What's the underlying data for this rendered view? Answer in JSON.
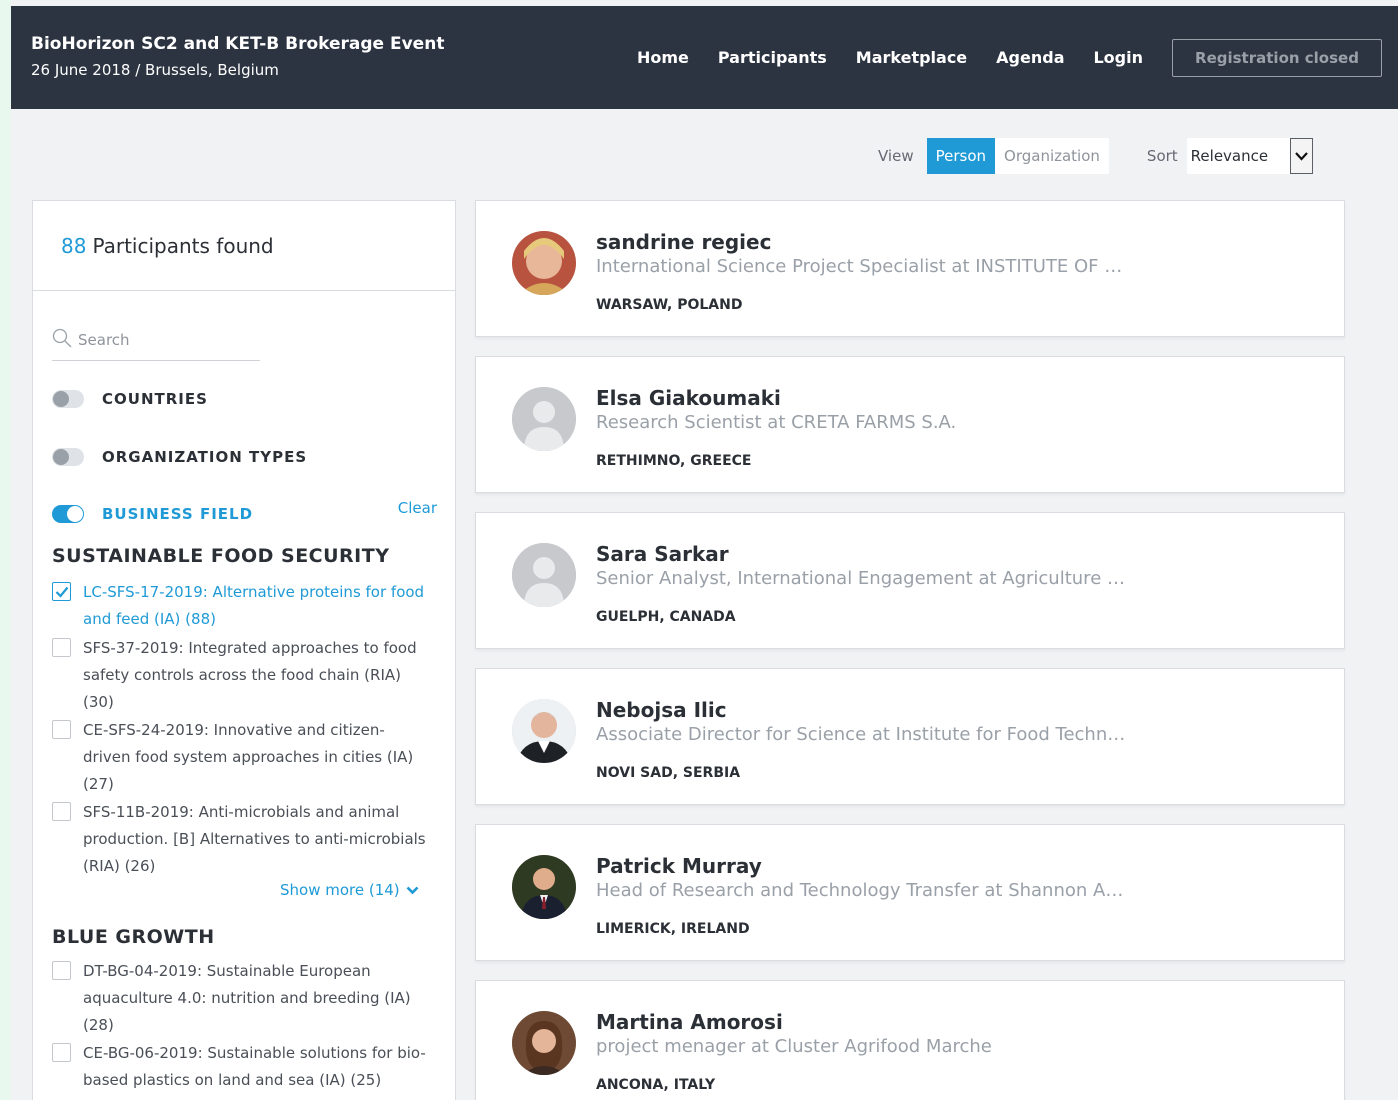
{
  "header": {
    "title": "BioHorizon SC2 and KET-B Brokerage Event",
    "subtitle": "26 June 2018 / Brussels, Belgium",
    "nav": [
      "Home",
      "Participants",
      "Marketplace",
      "Agenda",
      "Login"
    ],
    "registration_label": "Registration closed"
  },
  "toolbar": {
    "view_label": "View",
    "view_options": [
      "Person",
      "Organization"
    ],
    "view_selected": "Person",
    "sort_label": "Sort",
    "sort_value": "Relevance"
  },
  "sidebar": {
    "count": "88",
    "found_label": "Participants found",
    "search_placeholder": "Search",
    "filters": [
      {
        "label": "COUNTRIES",
        "on": false
      },
      {
        "label": "ORGANIZATION TYPES",
        "on": false
      },
      {
        "label": "BUSINESS FIELD",
        "on": true
      }
    ],
    "clear_label": "Clear",
    "sections": [
      {
        "title": "SUSTAINABLE FOOD SECURITY",
        "items": [
          {
            "label": "LC-SFS-17-2019: Alternative proteins for food and feed (IA) (88)",
            "checked": true
          },
          {
            "label": "SFS-37-2019: Integrated approaches to food safety controls across the food chain (RIA) (30)",
            "checked": false
          },
          {
            "label": "CE-SFS-24-2019: Innovative and citizen-driven food system approaches in cities (IA) (27)",
            "checked": false
          },
          {
            "label": "SFS-11B-2019: Anti-microbials and animal production. [B] Alternatives to anti-microbials (RIA) (26)",
            "checked": false
          }
        ],
        "show_more": "Show more (14)"
      },
      {
        "title": "BLUE GROWTH",
        "items": [
          {
            "label": "DT-BG-04-2019: Sustainable European aquaculture 4.0: nutrition and breeding (IA) (28)",
            "checked": false
          },
          {
            "label": "CE-BG-06-2019: Sustainable solutions for bio-based plastics on land and sea (IA) (25)",
            "checked": false
          }
        ]
      }
    ]
  },
  "participants": [
    {
      "name": "sandrine regiec",
      "role": "International Science Project Specialist at INSTITUTE OF …",
      "location": "WARSAW, POLAND",
      "avatar": "photo"
    },
    {
      "name": "Elsa Giakoumaki",
      "role": "Research Scientist at CRETA FARMS S.A.",
      "location": "RETHIMNO, GREECE",
      "avatar": "placeholder"
    },
    {
      "name": "Sara Sarkar",
      "role": "Senior Analyst, International Engagement at Agriculture a…",
      "location": "GUELPH, CANADA",
      "avatar": "placeholder"
    },
    {
      "name": "Nebojsa Ilic",
      "role": "Associate Director for Science at Institute for Food Techno…",
      "location": "NOVI SAD, SERBIA",
      "avatar": "photo"
    },
    {
      "name": "Patrick Murray",
      "role": "Head of Research and Technology Transfer at Shannon A…",
      "location": "LIMERICK, IRELAND",
      "avatar": "photo"
    },
    {
      "name": "Martina Amorosi",
      "role": "project menager at Cluster Agrifood Marche",
      "location": "ANCONA, ITALY",
      "avatar": "photo"
    }
  ],
  "colors": {
    "accent": "#1f9ad6",
    "header_bg": "#2c3441"
  }
}
